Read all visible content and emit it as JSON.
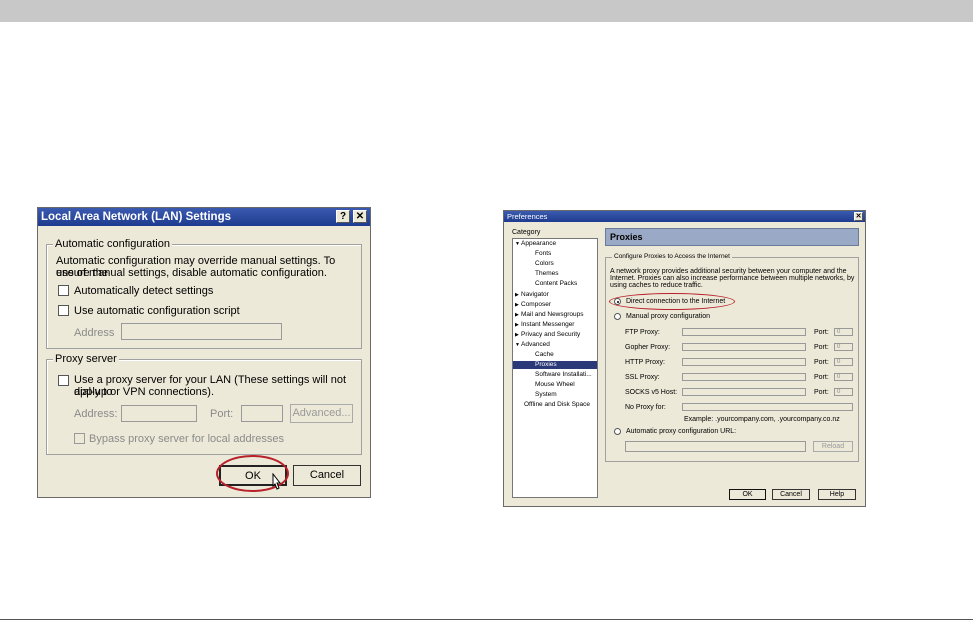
{
  "lan_dialog": {
    "title": "Local Area Network (LAN) Settings",
    "help_btn": "?",
    "close_btn": "✕",
    "auto_config": {
      "legend": "Automatic configuration",
      "description_line1": "Automatic configuration may override manual settings.  To ensure the",
      "description_line2": "use of manual settings, disable automatic configuration.",
      "detect_label": "Automatically detect settings",
      "script_label": "Use automatic configuration script",
      "address_label": "Address",
      "address_value": ""
    },
    "proxy": {
      "legend": "Proxy server",
      "use_proxy_line1": "Use a proxy server for your LAN (These settings will not apply to",
      "use_proxy_line2": "dial-up or VPN connections).",
      "address_label": "Address:",
      "port_label": "Port:",
      "advanced_label": "Advanced...",
      "bypass_label": "Bypass proxy server for local addresses"
    },
    "ok_label": "OK",
    "cancel_label": "Cancel"
  },
  "pref_dialog": {
    "title": "Preferences",
    "close_btn": "✕",
    "category_label": "Category",
    "tree": [
      {
        "label": "Appearance",
        "level": 0,
        "toggle": "▼"
      },
      {
        "label": "Fonts",
        "level": 1
      },
      {
        "label": "Colors",
        "level": 1
      },
      {
        "label": "Themes",
        "level": 1
      },
      {
        "label": "Content Packs",
        "level": 1
      },
      {
        "label": "Navigator",
        "level": 0,
        "toggle": "▶"
      },
      {
        "label": "Composer",
        "level": 0,
        "toggle": "▶"
      },
      {
        "label": "Mail and Newsgroups",
        "level": 0,
        "toggle": "▶"
      },
      {
        "label": "Instant Messenger",
        "level": 0,
        "toggle": "▶"
      },
      {
        "label": "Privacy and Security",
        "level": 0,
        "toggle": "▶"
      },
      {
        "label": "Advanced",
        "level": 0,
        "toggle": "▼"
      },
      {
        "label": "Cache",
        "level": 1
      },
      {
        "label": "Proxies",
        "level": 1,
        "selected": true
      },
      {
        "label": "Software Installati...",
        "level": 1
      },
      {
        "label": "Mouse Wheel",
        "level": 1
      },
      {
        "label": "System",
        "level": 1
      },
      {
        "label": "Offline and Disk Space",
        "level": 0
      }
    ],
    "panel_title": "Proxies",
    "group_legend": "Configure Proxies to Access the Internet",
    "desc_line1": "A network proxy provides additional security between your computer and the",
    "desc_line2": "Internet. Proxies can also increase performance between multiple networks, by",
    "desc_line3": "using caches to reduce traffic.",
    "direct_label": "Direct connection to the Internet",
    "manual_label": "Manual proxy configuration",
    "proxies": [
      {
        "label": "FTP Proxy:",
        "port_label": "Port:",
        "port_value": "0"
      },
      {
        "label": "Gopher Proxy:",
        "port_label": "Port:",
        "port_value": "0"
      },
      {
        "label": "HTTP Proxy:",
        "port_label": "Port:",
        "port_value": "0"
      },
      {
        "label": "SSL Proxy:",
        "port_label": "Port:",
        "port_value": "0"
      },
      {
        "label": "SOCKS v5 Host:",
        "port_label": "Port:",
        "port_value": "0"
      }
    ],
    "no_proxy_label": "No Proxy for:",
    "example": "Example: .yourcompany.com, .yourcompany.co.nz",
    "auto_url_label": "Automatic proxy configuration URL:",
    "reload_label": "Reload",
    "ok_label": "OK",
    "cancel_label": "Cancel",
    "help_label": "Help"
  }
}
